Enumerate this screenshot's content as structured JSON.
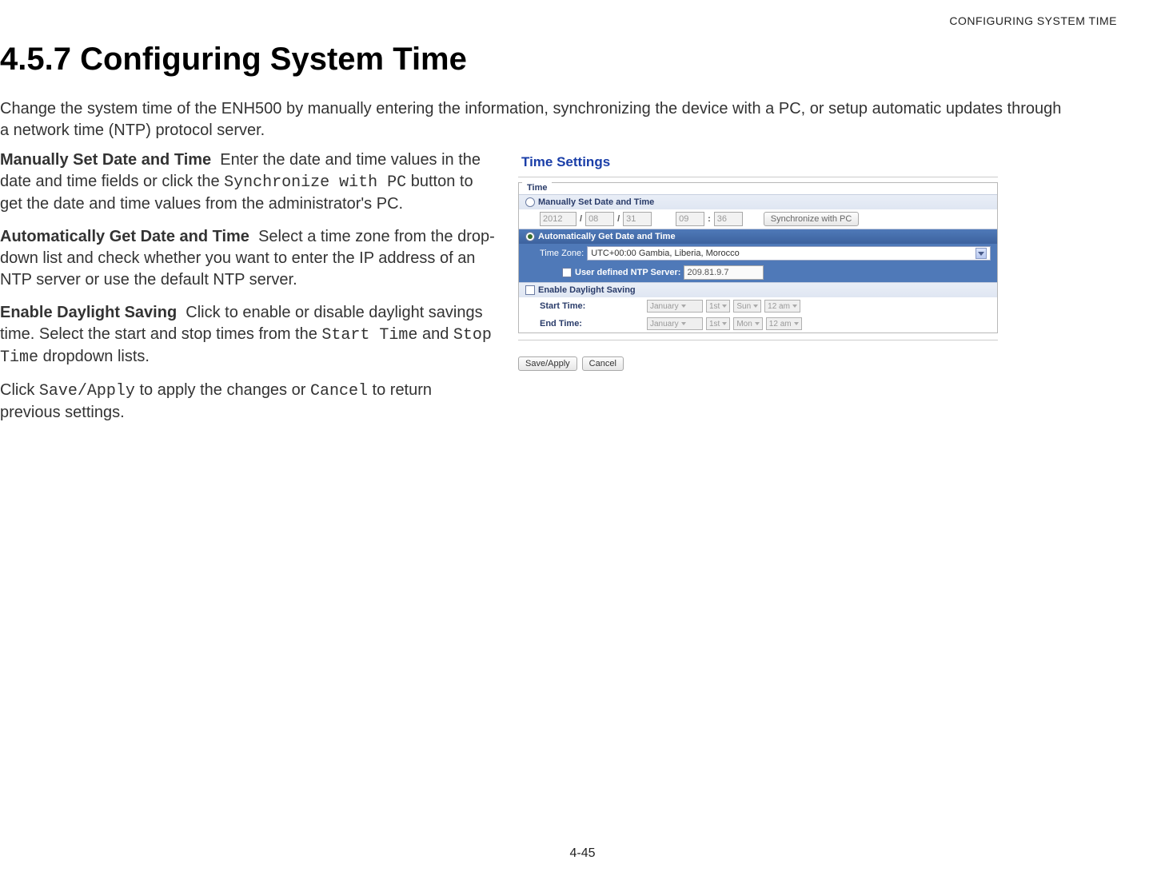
{
  "running_head": "CONFIGURING SYSTEM TIME",
  "section_number": "4.5.7",
  "section_title": "Configuring System Time",
  "intro": "Change the system time of the ENH500 by manually entering the information, synchronizing the device with a PC, or setup automatic updates through a network time (NTP) protocol server.",
  "blocks": {
    "manual": {
      "term": "Manually Set Date and Time",
      "body_pre": "Enter the date and time values in the date and time fields or click the ",
      "code": "Synchronize with PC",
      "body_post": " button to get the date and time values from the administrator's PC."
    },
    "auto": {
      "term": "Automatically Get Date and Time",
      "body": "Select a time zone from the drop-down list and check whether you want to enter the IP address of an NTP server or use the default NTP server."
    },
    "dst": {
      "term": "Enable Daylight Saving",
      "body_pre": "Click to enable or disable daylight savings time. Select the start and stop times from the ",
      "code1": "Start Time",
      "mid": " and ",
      "code2": "Stop Time",
      "body_post": " dropdown lists."
    },
    "save": {
      "pre": "Click ",
      "code1": "Save/Apply",
      "mid": " to apply the changes or ",
      "code2": "Cancel",
      "post": " to return previous settings."
    }
  },
  "shot": {
    "title": "Time Settings",
    "group": "Time",
    "manual_label": "Manually Set Date and Time",
    "year": "2012",
    "month": "08",
    "day": "31",
    "hour": "09",
    "minute": "36",
    "sync_btn": "Synchronize with PC",
    "auto_label": "Automatically Get Date and Time",
    "tz_label": "Time Zone:",
    "tz_value": "UTC+00:00 Gambia, Liberia, Morocco",
    "ntp_label": "User defined NTP Server:",
    "ntp_value": "209.81.9.7",
    "dst_label": "Enable Daylight Saving",
    "start_label": "Start Time:",
    "end_label": "End Time:",
    "dd_month": "January",
    "dd_week": "1st",
    "dd_day_start": "Sun",
    "dd_day_end": "Mon",
    "dd_hour": "12 am",
    "save_btn": "Save/Apply",
    "cancel_btn": "Cancel"
  },
  "page_num": "4-45"
}
